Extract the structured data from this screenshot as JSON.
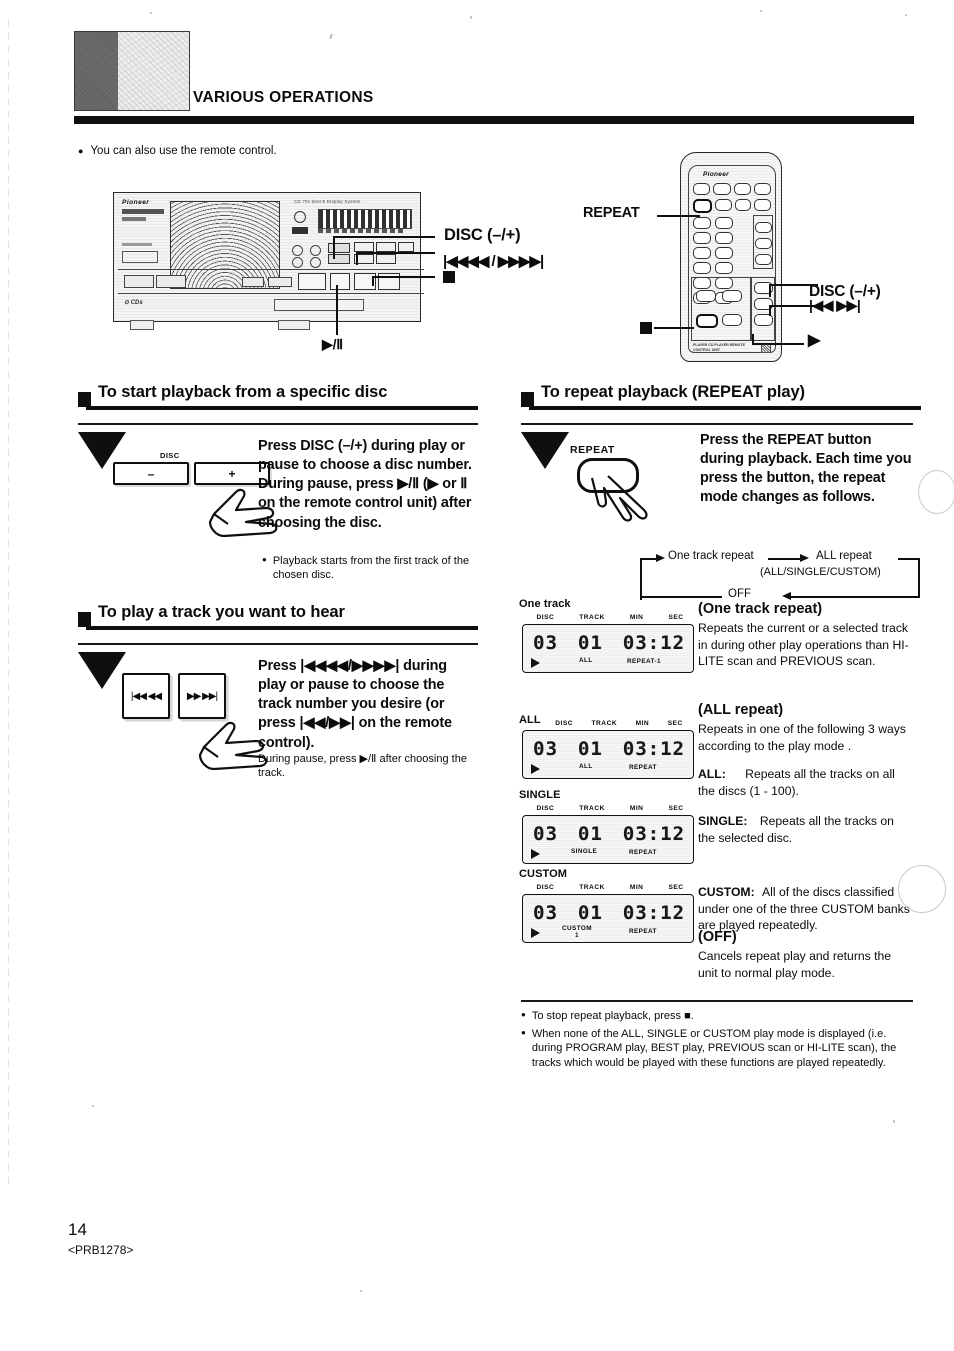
{
  "header": {
    "title": "VARIOUS OPERATIONS",
    "intro_bullet": "You can also use the remote control.",
    "bullet_glyph": "●"
  },
  "player_diagram": {
    "name": "cd-player-front-panel",
    "brand": "Pioneer",
    "callouts": [
      {
        "label": "DISC (–/+)",
        "name": "callout-disc"
      },
      {
        "label": "|◀◀◀◀ / ▶▶▶▶|",
        "name": "callout-skip"
      },
      {
        "label": "■",
        "name": "callout-stop"
      },
      {
        "label": "▶/Ⅱ",
        "name": "callout-play-pause"
      }
    ]
  },
  "remote_diagram": {
    "name": "remote-control-unit",
    "brand": "Pioneer",
    "footer_text": "PLAYER CD PLAYER REMOTE CONTROL UNIT",
    "callouts": [
      {
        "label": "REPEAT",
        "name": "callout-repeat"
      },
      {
        "label": "DISC (–/+)",
        "name": "callout-remote-disc"
      },
      {
        "label": "|◀◀  ▶▶|",
        "name": "callout-remote-skip"
      },
      {
        "label": "■",
        "name": "callout-remote-stop"
      },
      {
        "label": "▶",
        "name": "callout-remote-play"
      }
    ]
  },
  "sections": [
    {
      "id": "specific-disc",
      "heading": "To start playback from a specific disc",
      "button_art": {
        "group_label": "DISC",
        "minus": "–",
        "plus": "+"
      },
      "instruction": "Press DISC (–/+) during play or pause to choose a disc number. During pause, press ▶/Ⅱ (▶ or Ⅱ on the remote control unit) after choosing the disc.",
      "notes": [
        "Playback starts from the first track of the chosen disc."
      ]
    },
    {
      "id": "play-track",
      "heading": "To play a track you want to hear",
      "button_art": {
        "prev": "|◀◀ ◀◀",
        "next": "▶▶ ▶▶|"
      },
      "instruction": "Press |◀◀◀◀/▶▶▶▶| during play or pause to choose the track number you desire (or press |◀◀/▶▶| on the remote control).",
      "sub_note": "During pause, press ▶/Ⅱ after choosing the track."
    },
    {
      "id": "repeat-play",
      "heading": "To repeat playback (REPEAT play)",
      "button_art": {
        "label": "REPEAT"
      },
      "instruction": "Press the REPEAT button during playback. Each time you press the button, the repeat mode changes as follows."
    }
  ],
  "repeat_flow": {
    "step1": "One track repeat",
    "step2": "ALL repeat",
    "step2_sub": "(ALL/SINGLE/CUSTOM)",
    "step3": "OFF"
  },
  "lcd_displays": [
    {
      "tag": "One track",
      "name": "lcd-one-track",
      "column_headers": [
        "DISC",
        "TRACK",
        "MIN",
        "SEC"
      ],
      "disc": "03",
      "track": "01",
      "min": "03",
      "sec": "12",
      "separator": ":",
      "play_indicator": "▶",
      "mode_indicator": "ALL",
      "mode_sub": "",
      "repeat_indicator": "REPEAT-1"
    },
    {
      "tag": "ALL",
      "name": "lcd-all",
      "column_headers": [
        "DISC",
        "TRACK",
        "MIN",
        "SEC"
      ],
      "disc": "03",
      "track": "01",
      "min": "03",
      "sec": "12",
      "separator": ":",
      "play_indicator": "▶",
      "mode_indicator": "ALL",
      "mode_sub": "",
      "repeat_indicator": "REPEAT"
    },
    {
      "tag": "SINGLE",
      "name": "lcd-single",
      "column_headers": [
        "DISC",
        "TRACK",
        "MIN",
        "SEC"
      ],
      "disc": "03",
      "track": "01",
      "min": "03",
      "sec": "12",
      "separator": ":",
      "play_indicator": "▶",
      "mode_indicator": "SINGLE",
      "mode_sub": "",
      "repeat_indicator": "REPEAT"
    },
    {
      "tag": "CUSTOM",
      "name": "lcd-custom",
      "column_headers": [
        "DISC",
        "TRACK",
        "MIN",
        "SEC"
      ],
      "disc": "03",
      "track": "01",
      "min": "03",
      "sec": "12",
      "separator": ":",
      "play_indicator": "▶",
      "mode_indicator": "CUSTOM",
      "mode_sub": "1",
      "repeat_indicator": "REPEAT"
    }
  ],
  "mode_descriptions": [
    {
      "title": "(One track repeat)",
      "body": "Repeats the current or a selected track in during other play operations than HI-LITE scan and PREVIOUS scan."
    },
    {
      "title": "(ALL repeat)",
      "body": "Repeats in one of the following 3 ways according to the play mode ."
    }
  ],
  "mode_items": [
    {
      "label": "ALL:",
      "text": "Repeats all the tracks on all the discs (1 - 100)."
    },
    {
      "label": "SINGLE:",
      "text": "Repeats all the tracks on the selected disc."
    },
    {
      "label": "CUSTOM:",
      "text": "All of the discs classified under one of the three CUSTOM banks are played repeatedly."
    }
  ],
  "off_mode": {
    "title": "(OFF)",
    "body": "Cancels repeat play and returns the unit to normal play mode."
  },
  "footer_notes": [
    "To stop repeat playback, press ■.",
    "When none of the ALL, SINGLE or CUSTOM play mode is displayed (i.e. during PROGRAM play, BEST play, PREVIOUS scan or HI-LITE scan), the tracks which would be played with these functions are played repeatedly."
  ],
  "footer": {
    "page_number": "14",
    "doc_code": "<PRB1278>"
  }
}
